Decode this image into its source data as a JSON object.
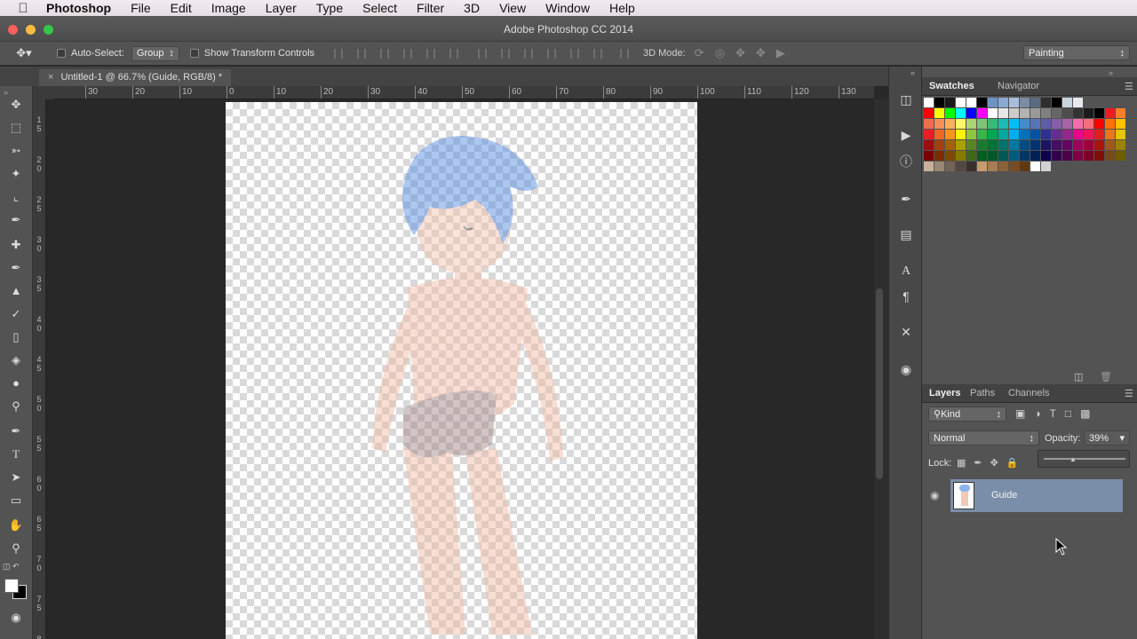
{
  "menubar": {
    "app_name": "Photoshop",
    "items": [
      "File",
      "Edit",
      "Image",
      "Layer",
      "Type",
      "Select",
      "Filter",
      "3D",
      "View",
      "Window",
      "Help"
    ]
  },
  "window": {
    "title": "Adobe Photoshop CC 2014"
  },
  "options_bar": {
    "auto_select_label": "Auto-Select:",
    "auto_select_value": "Group",
    "show_transform_label": "Show Transform Controls",
    "mode_3d_label": "3D Mode:",
    "workspace": "Painting"
  },
  "document": {
    "tab_title": "Untitled-1 @ 66.7% (Guide, RGB/8) *"
  },
  "rulers": {
    "horizontal": [
      "30",
      "20",
      "10",
      "0",
      "10",
      "20",
      "30",
      "40",
      "50",
      "60",
      "70",
      "80",
      "90",
      "100",
      "110",
      "120",
      "130"
    ],
    "vertical": [
      "1\n5",
      "2\n0",
      "2\n5",
      "3\n0",
      "3\n5",
      "4\n0",
      "4\n5",
      "5\n0",
      "5\n5",
      "6\n0",
      "6\n5",
      "7\n0",
      "7\n5",
      "8"
    ]
  },
  "panels": {
    "top_tabs": [
      "Swatches",
      "Navigator"
    ],
    "layers_tabs": [
      "Layers",
      "Paths",
      "Channels"
    ],
    "kind_filter": "Kind",
    "blend_mode": "Normal",
    "opacity_label": "Opacity:",
    "opacity_value": "39%",
    "lock_label": "Lock:",
    "layers": [
      {
        "name": "Guide",
        "visible": true,
        "selected": true
      }
    ]
  },
  "colors": {
    "selected_layer": "#7a8eaa",
    "panel_bg": "#535353",
    "pasteboard": "#282828"
  },
  "swatch_rows": [
    [
      "#ffffff",
      "#000000",
      "#1a1a1a",
      "#ffffff",
      "#ffffff",
      "#000000",
      "#6d93c5",
      "#8aa9d2",
      "#a8bfdc",
      "#7a8ca6",
      "#5a6a80",
      "#2e2e2e",
      "#000000",
      "#c8d4e0",
      "#e6eaee"
    ],
    [
      "#ff0000",
      "#ffff00",
      "#00ff00",
      "#00ffff",
      "#0000ff",
      "#ff00ff",
      "#ffffff",
      "#e6e6e6",
      "#cccccc",
      "#b3b3b3",
      "#999999",
      "#808080",
      "#666666",
      "#4d4d4d",
      "#333333",
      "#1a1a1a",
      "#000000",
      "#ed1c24",
      "#ff7f27"
    ],
    [
      "#f26c4f",
      "#f68e56",
      "#fbaf5d",
      "#fff568",
      "#acd373",
      "#7cc576",
      "#3bb878",
      "#1abbb4",
      "#00bff3",
      "#438ccb",
      "#5574b9",
      "#605ca8",
      "#855fa8",
      "#a864a8",
      "#f06eaa",
      "#f26d7d",
      "#ff0000",
      "#ff7300",
      "#ffc000"
    ],
    [
      "#ed1c24",
      "#f26522",
      "#f7941d",
      "#fff200",
      "#8dc63f",
      "#39b54a",
      "#00a651",
      "#00a99d",
      "#00aeef",
      "#0072bc",
      "#0054a6",
      "#2e3192",
      "#662d91",
      "#92278f",
      "#ec008c",
      "#ed145b",
      "#e21d1d",
      "#e87722",
      "#e8c300"
    ],
    [
      "#9e0b0f",
      "#a0410d",
      "#a36209",
      "#aba000",
      "#598527",
      "#1a7b30",
      "#007236",
      "#00746b",
      "#0076a3",
      "#004b80",
      "#003471",
      "#1b1464",
      "#440e62",
      "#630460",
      "#9e005d",
      "#9e0039",
      "#a8150a",
      "#a1581f",
      "#9a8300"
    ],
    [
      "#790000",
      "#7b2e00",
      "#7d4900",
      "#827b00",
      "#406618",
      "#005e20",
      "#005826",
      "#005952",
      "#005b7f",
      "#003663",
      "#002157",
      "#0d004c",
      "#32004b",
      "#4b0049",
      "#7b0046",
      "#7a0026",
      "#7d0f0a",
      "#754a1c",
      "#6f5d00"
    ],
    [
      "#c7b299",
      "#998675",
      "#736357",
      "#534741",
      "#37302d",
      "#c69c6d",
      "#a67c52",
      "#8c6239",
      "#754c24",
      "#603913",
      "#ffffff",
      "#d2d2d2"
    ]
  ]
}
